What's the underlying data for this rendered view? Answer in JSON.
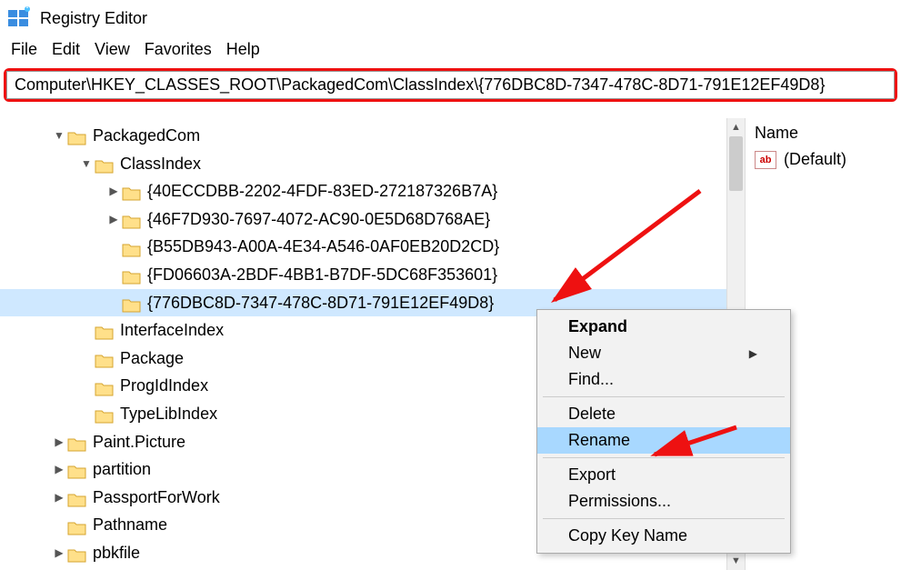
{
  "app": {
    "title": "Registry Editor"
  },
  "menu": {
    "file": "File",
    "edit": "Edit",
    "view": "View",
    "favorites": "Favorites",
    "help": "Help"
  },
  "address": "Computer\\HKEY_CLASSES_ROOT\\PackagedCom\\ClassIndex\\{776DBC8D-7347-478C-8D71-791E12EF49D8}",
  "tree": {
    "packagedcom": "PackagedCom",
    "classindex": "ClassIndex",
    "guid1": "{40ECCDBB-2202-4FDF-83ED-272187326B7A}",
    "guid2": "{46F7D930-7697-4072-AC90-0E5D68D768AE}",
    "guid3": "{B55DB943-A00A-4E34-A546-0AF0EB20D2CD}",
    "guid4": "{FD06603A-2BDF-4BB1-B7DF-5DC68F353601}",
    "guid5": "{776DBC8D-7347-478C-8D71-791E12EF49D8}",
    "interfaceindex": "InterfaceIndex",
    "package": "Package",
    "progidindex": "ProgIdIndex",
    "typelibindex": "TypeLibIndex",
    "paintpicture": "Paint.Picture",
    "partition": "partition",
    "passportforwork": "PassportForWork",
    "pathname": "Pathname",
    "pbkfile": "pbkfile"
  },
  "values": {
    "header_name": "Name",
    "default_value": "(Default)"
  },
  "contextmenu": {
    "expand": "Expand",
    "new": "New",
    "find": "Find...",
    "delete": "Delete",
    "rename": "Rename",
    "export": "Export",
    "permissions": "Permissions...",
    "copykeyname": "Copy Key Name"
  }
}
